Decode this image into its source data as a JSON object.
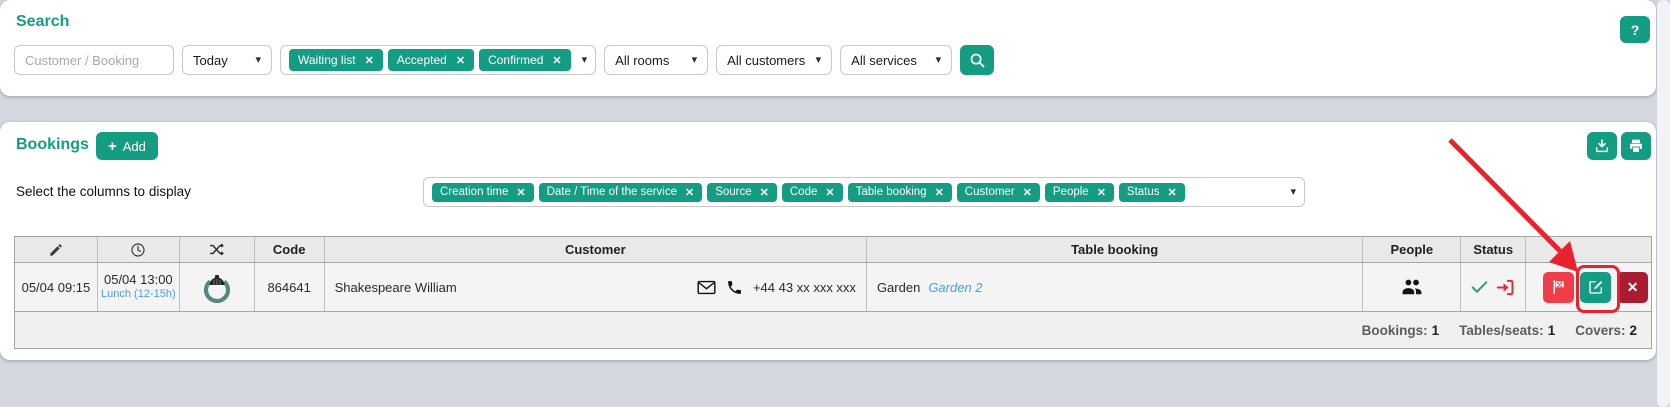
{
  "colors": {
    "accent_teal": "#149d82",
    "link_blue": "#4a9fd8",
    "noshow_red": "#ef3e4a",
    "cancel_dark_red": "#a81c34",
    "annotation_red": "#e8232f",
    "status_check_green": "#2e9e6a"
  },
  "icons": {
    "close": "✕",
    "caret": "▾",
    "plus": "+",
    "help": "?"
  },
  "search": {
    "title": "Search",
    "customer_placeholder": "Customer / Booking",
    "date_filter": "Today",
    "status_tags": [
      "Waiting list",
      "Accepted",
      "Confirmed"
    ],
    "rooms_filter": "All rooms",
    "customers_filter": "All customers",
    "services_filter": "All services"
  },
  "bookings": {
    "title": "Bookings",
    "add_label": "Add",
    "columns_hint": "Select the columns to display",
    "column_tags": [
      "Creation time",
      "Date / Time of the service",
      "Source",
      "Code",
      "Table booking",
      "Customer",
      "People",
      "Status"
    ]
  },
  "table": {
    "headers": {
      "code": "Code",
      "customer": "Customer",
      "table_booking": "Table booking",
      "people": "People",
      "status": "Status"
    },
    "row": {
      "creation_time": "05/04 09:15",
      "service_time": "05/04 13:00",
      "service_name": "Lunch (12-15h)",
      "code": "864641",
      "customer_name": "Shakespeare William",
      "customer_phone": "+44 43 xx xxx xxx",
      "room_name": "Garden",
      "table_name": "Garden 2"
    },
    "totals": {
      "bookings_label": "Bookings:",
      "bookings_value": "1",
      "tables_label": "Tables/seats:",
      "tables_value": "1",
      "covers_label": "Covers:",
      "covers_value": "2"
    }
  }
}
